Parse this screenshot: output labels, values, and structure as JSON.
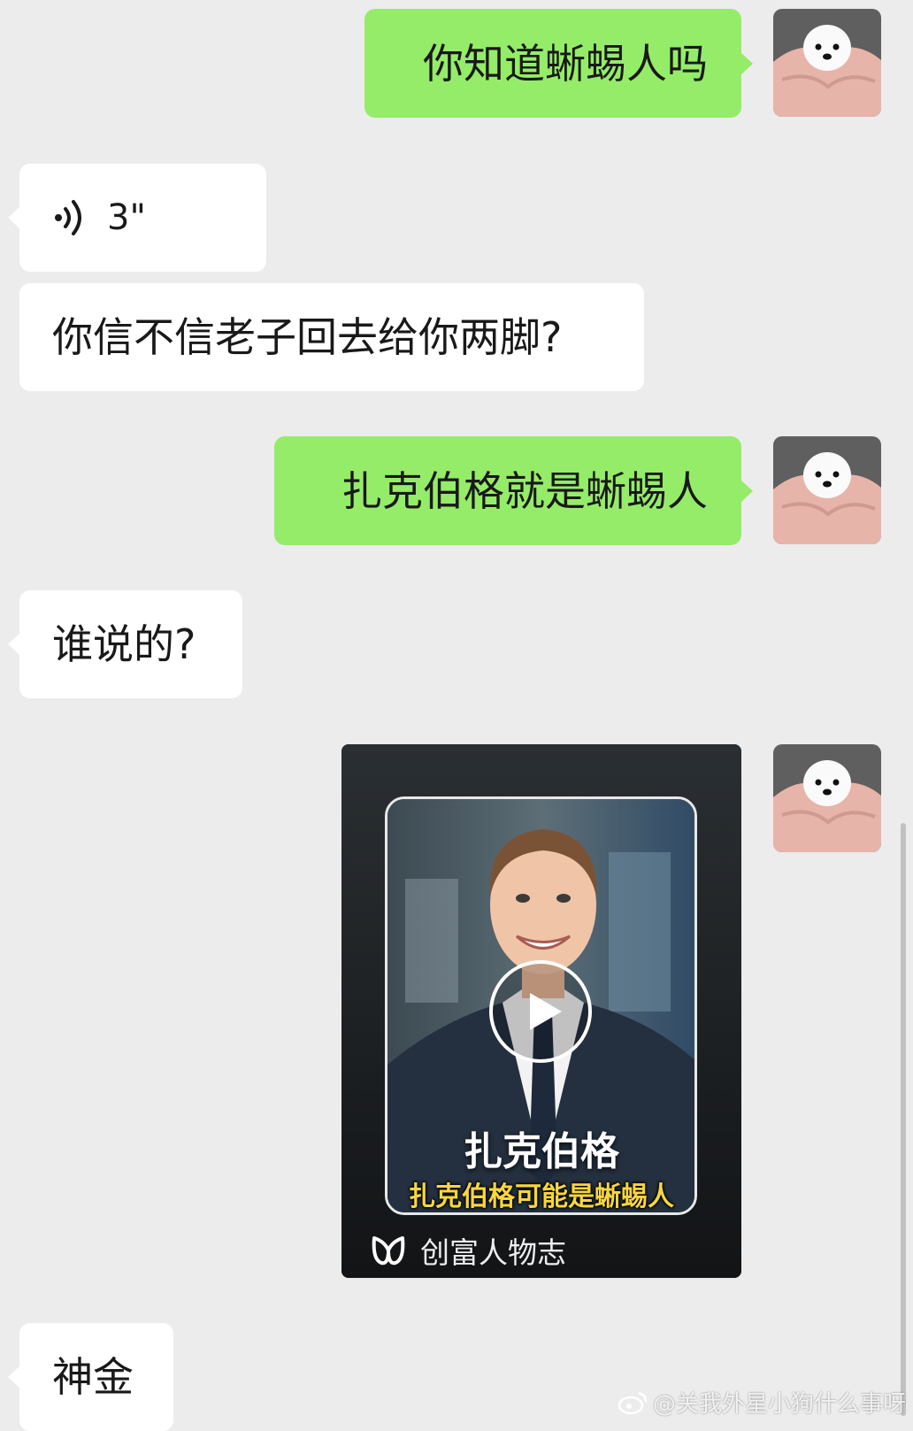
{
  "messages": {
    "m1": {
      "text": "你知道蜥蜴人吗"
    },
    "m2": {
      "duration": "3\""
    },
    "m3": {
      "text": "你信不信老子回去给你两脚?"
    },
    "m4": {
      "text": "扎克伯格就是蜥蜴人"
    },
    "m5": {
      "text": "谁说的?"
    },
    "m7": {
      "text": "神金"
    }
  },
  "video": {
    "title": "扎克伯格",
    "subtitle": "扎克伯格可能是蜥蜴人",
    "brand": "创富人物志"
  },
  "watermark": {
    "text": "@关我外星小狗什么事呀"
  },
  "colors": {
    "background": "#ececec",
    "sent_bubble": "#95ec69",
    "received_bubble": "#ffffff",
    "subtitle_yellow": "#f7d640"
  },
  "icons": {
    "voice": "voice-wave-icon",
    "play": "play-icon",
    "brand": "brand-logo-icon",
    "weibo": "weibo-icon"
  }
}
